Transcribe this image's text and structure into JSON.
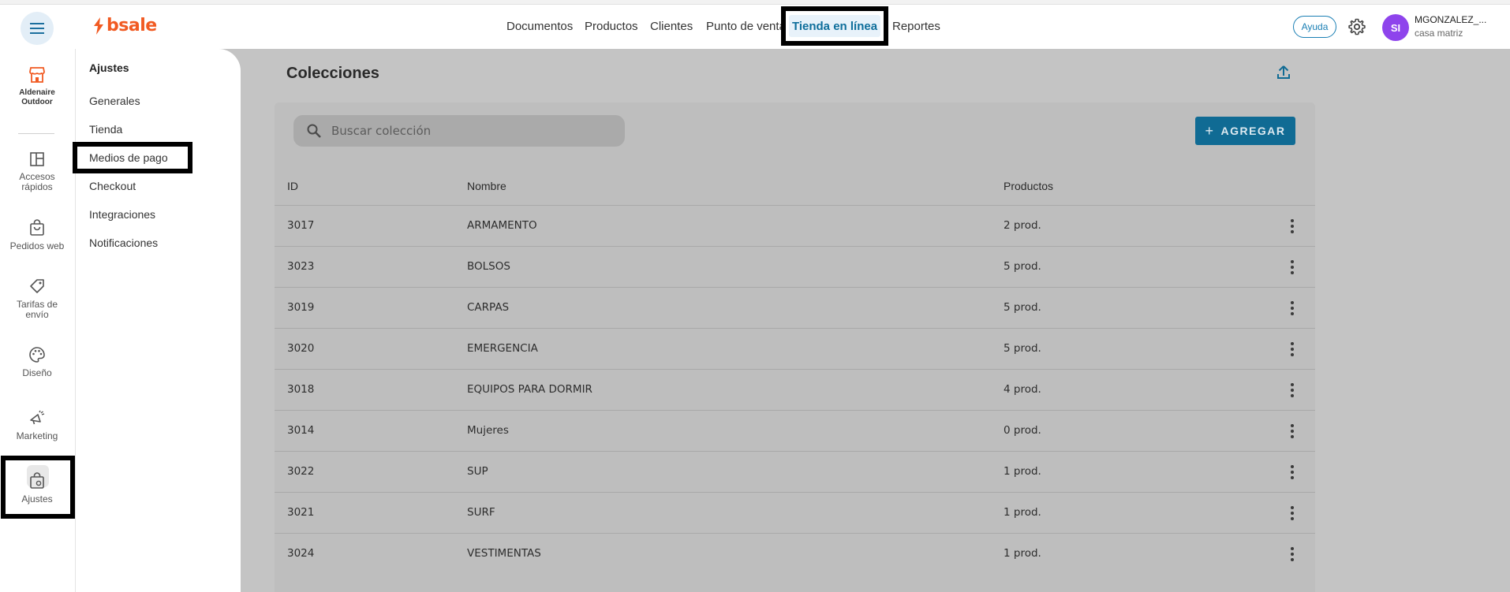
{
  "brand": {
    "name": "bsale",
    "color": "#f15a22"
  },
  "top_nav": {
    "items": [
      "Documentos",
      "Productos",
      "Clientes",
      "Punto de venta",
      "Tienda en línea",
      "Reportes"
    ],
    "active": "Tienda en línea"
  },
  "header": {
    "help_label": "Ayuda",
    "avatar_initials": "SI",
    "user_name": "MGONZALEZ_...",
    "branch": "casa matriz"
  },
  "rail": {
    "store_name_line1": "Aldenaire",
    "store_name_line2": "Outdoor",
    "items": [
      {
        "line1": "Accesos",
        "line2": "rápidos",
        "icon": "dashboard-icon"
      },
      {
        "line1": "Pedidos web",
        "line2": "",
        "icon": "shopping-bag-icon"
      },
      {
        "line1": "Tarifas de",
        "line2": "envío",
        "icon": "tag-icon"
      },
      {
        "line1": "Diseño",
        "line2": "",
        "icon": "palette-icon"
      },
      {
        "line1": "Marketing",
        "line2": "",
        "icon": "megaphone-icon"
      },
      {
        "line1": "Ajustes",
        "line2": "",
        "icon": "settings-bag-icon"
      }
    ],
    "active": "Ajustes"
  },
  "settings_panel": {
    "title": "Ajustes",
    "links": [
      "Generales",
      "Tienda",
      "Medios de pago",
      "Checkout",
      "Integraciones",
      "Notificaciones"
    ],
    "active": "Medios de pago"
  },
  "main": {
    "title": "Colecciones",
    "search": {
      "placeholder": "Buscar colección",
      "value": ""
    },
    "add_label": "AGREGAR",
    "columns": {
      "id": "ID",
      "name": "Nombre",
      "products": "Productos"
    },
    "rows": [
      {
        "id": "3017",
        "name": "ARMAMENTO",
        "products": "2 prod."
      },
      {
        "id": "3023",
        "name": "BOLSOS",
        "products": "5 prod."
      },
      {
        "id": "3019",
        "name": "CARPAS",
        "products": "5 prod."
      },
      {
        "id": "3020",
        "name": "EMERGENCIA",
        "products": "5 prod."
      },
      {
        "id": "3018",
        "name": "EQUIPOS PARA DORMIR",
        "products": "4 prod."
      },
      {
        "id": "3014",
        "name": "Mujeres",
        "products": "0 prod."
      },
      {
        "id": "3022",
        "name": "SUP",
        "products": "1 prod."
      },
      {
        "id": "3021",
        "name": "SURF",
        "products": "1 prod."
      },
      {
        "id": "3024",
        "name": "VESTIMENTAS",
        "products": "1 prod."
      }
    ]
  },
  "colors": {
    "accent": "#106b94",
    "link": "#1a7fb4",
    "avatar": "#8e44ec"
  }
}
